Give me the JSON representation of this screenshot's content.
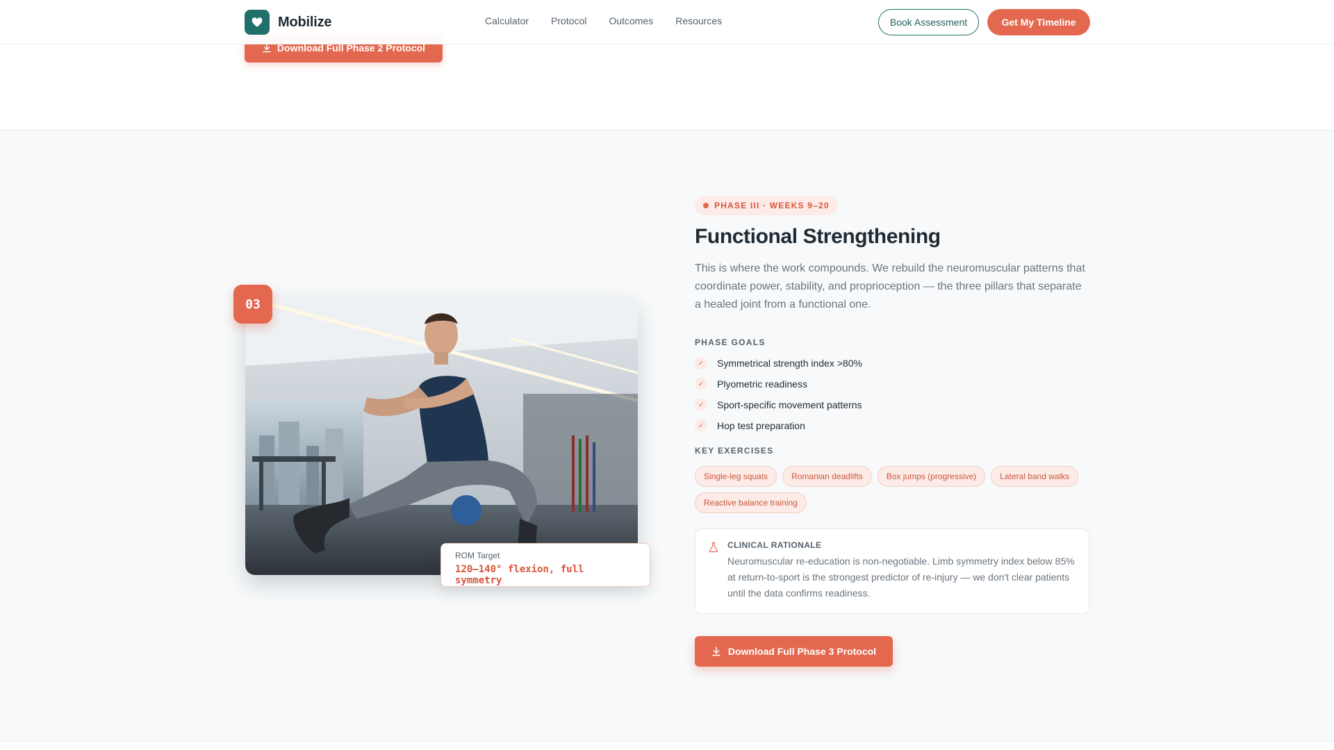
{
  "header": {
    "brand": "Mobilize",
    "nav": [
      "Calculator",
      "Protocol",
      "Outcomes",
      "Resources"
    ],
    "book_label": "Book Assessment",
    "timeline_label": "Get My Timeline"
  },
  "previous": {
    "download_label": "Download Full Phase 2 Protocol"
  },
  "phase": {
    "number": "03",
    "pill": "PHASE III · WEEKS 9–20",
    "title": "Functional Strengthening",
    "lead": "This is where the work compounds. We rebuild the neuromuscular patterns that coordinate power, stability, and proprioception — the three pillars that separate a healed joint from a functional one.",
    "goals_label": "PHASE GOALS",
    "goals": [
      "Symmetrical strength index >80%",
      "Plyometric readiness",
      "Sport-specific movement patterns",
      "Hop test preparation"
    ],
    "exercises_label": "KEY EXERCISES",
    "exercises": [
      "Single-leg squats",
      "Romanian deadlifts",
      "Box jumps (progressive)",
      "Lateral band walks",
      "Reactive balance training"
    ],
    "rom_label": "ROM Target",
    "rom_value": "120–140° flexion, full symmetry",
    "rationale_title": "CLINICAL RATIONALE",
    "rationale_body": "Neuromuscular re-education is non-negotiable. Limb symmetry index below 85% at return-to-sport is the strongest predictor of re-injury — we don't clear patients until the data confirms readiness.",
    "download_label": "Download Full Phase 3 Protocol"
  },
  "colors": {
    "brand": "#1f6f6a",
    "accent": "#e3684f",
    "accent_soft": "#fcebe6"
  },
  "icons": [
    "heart-icon",
    "download-icon",
    "check-icon",
    "flask-icon"
  ]
}
